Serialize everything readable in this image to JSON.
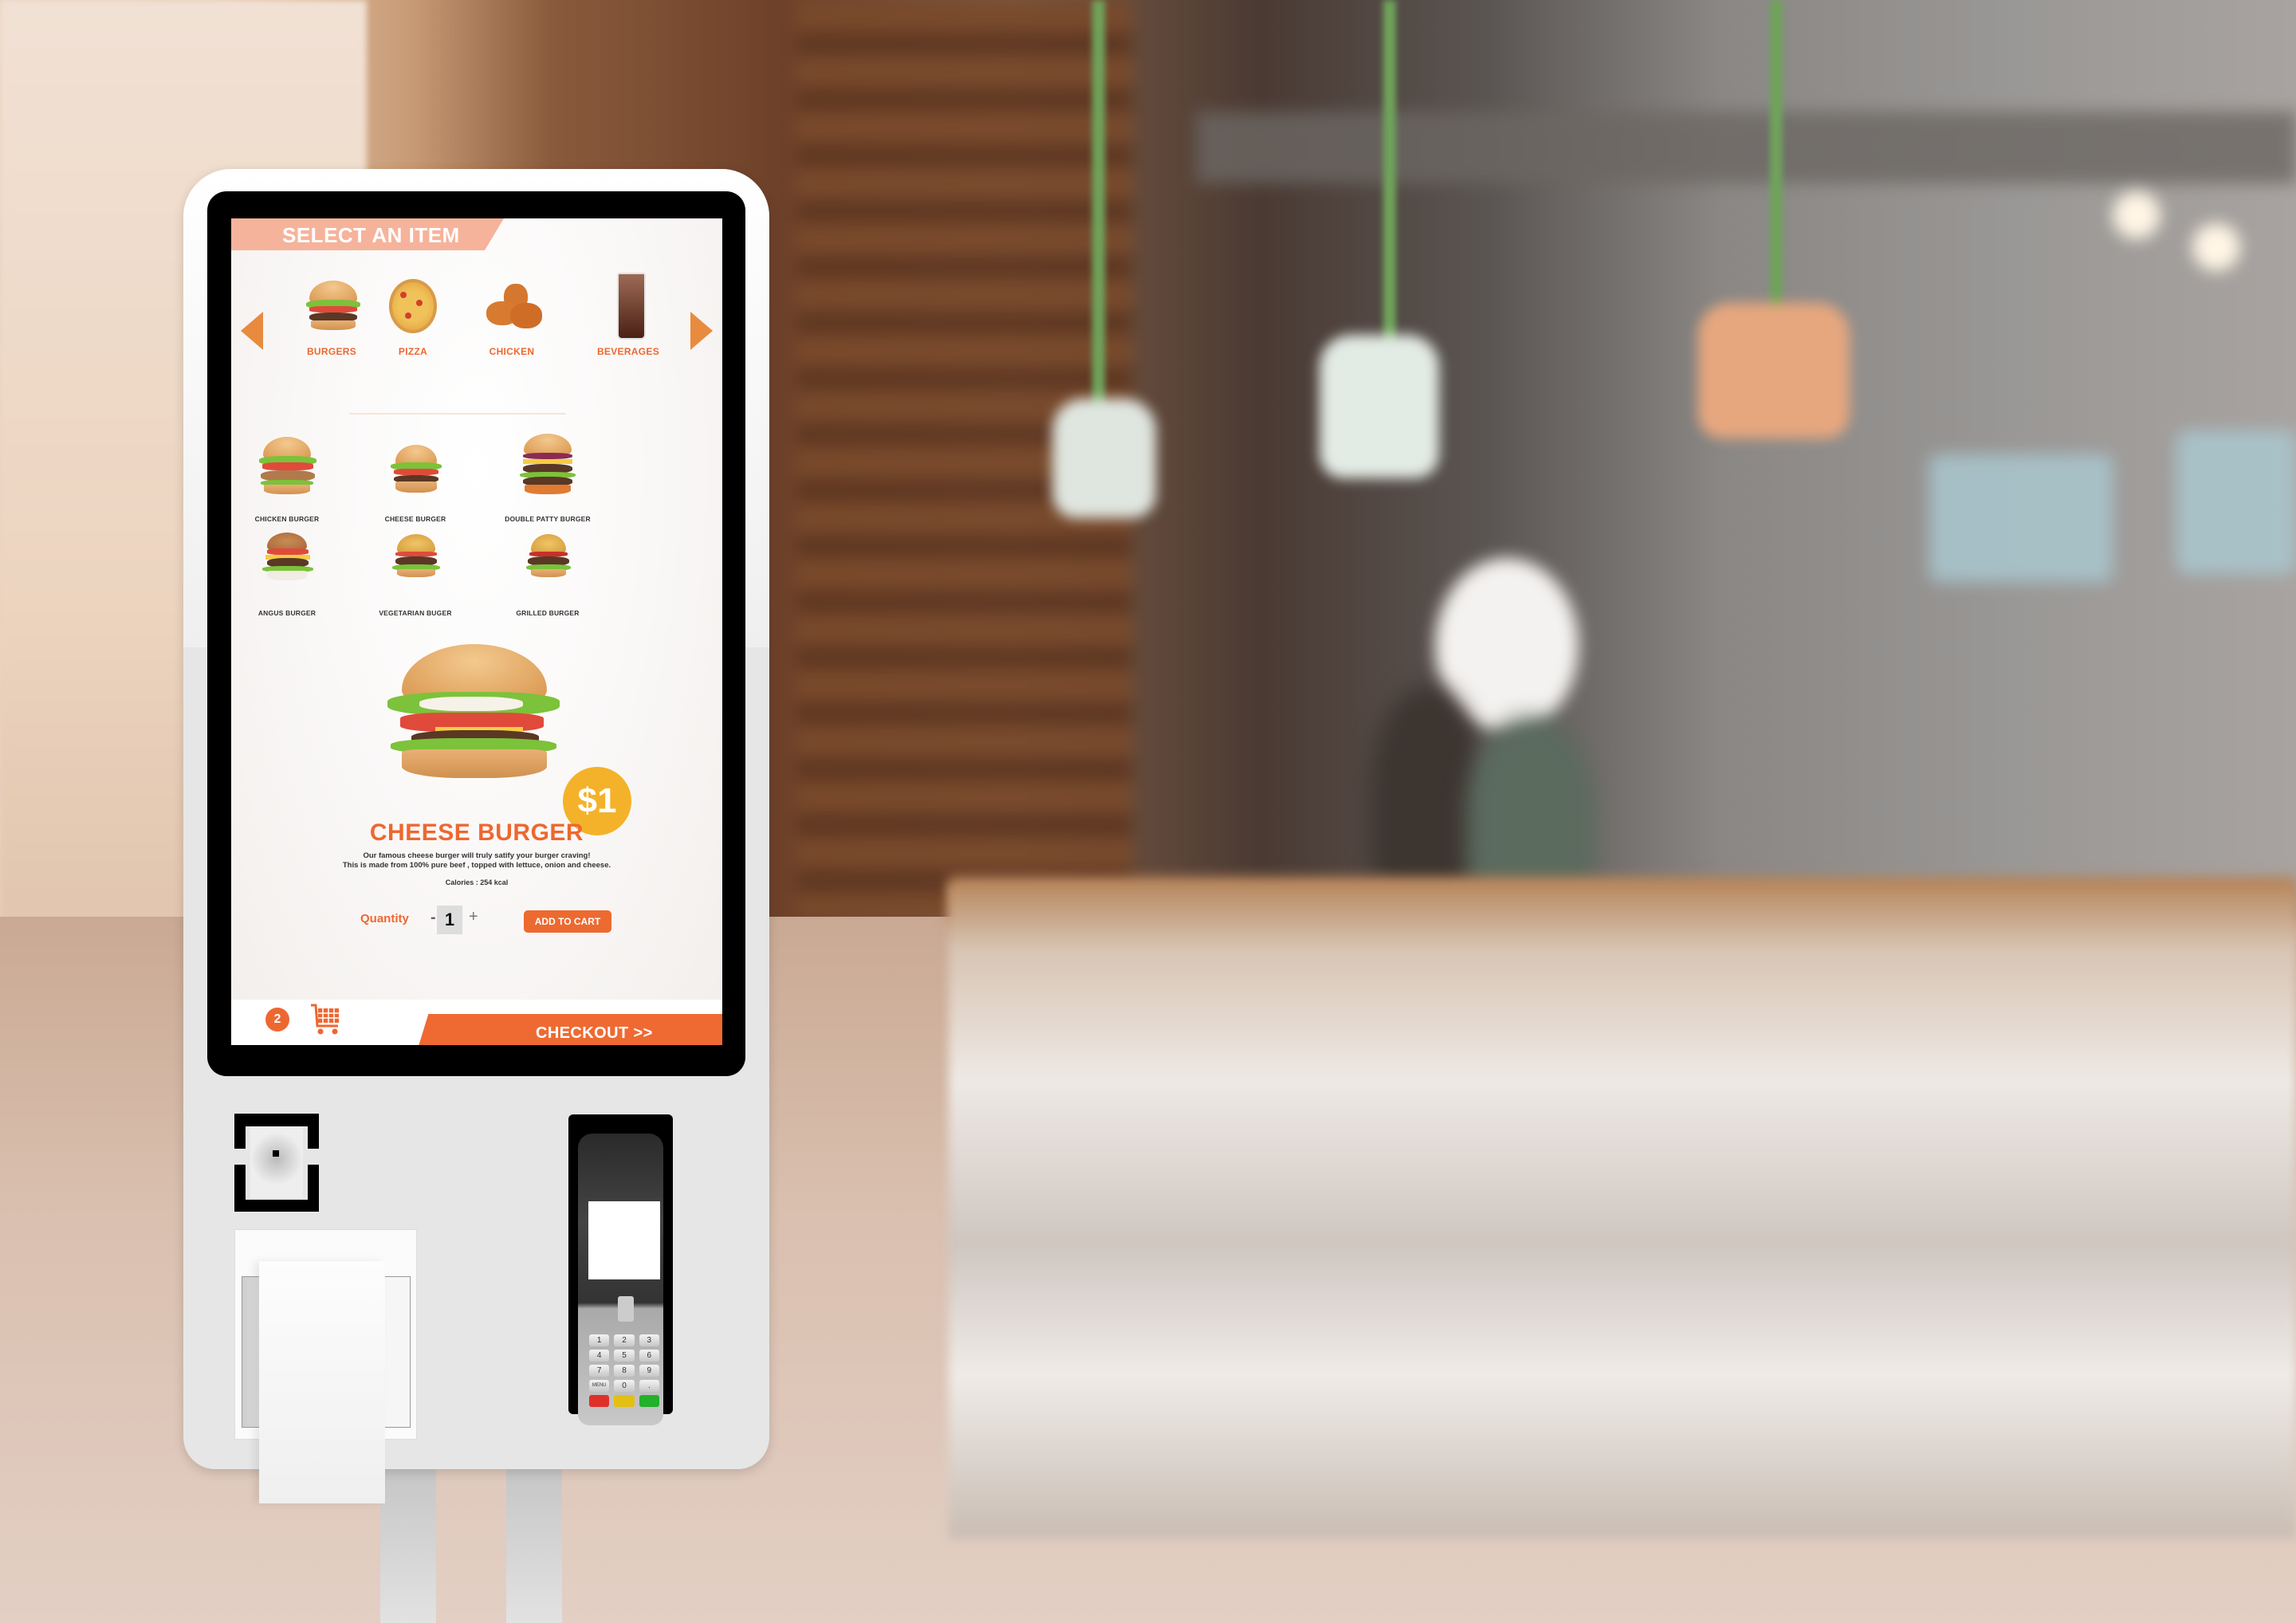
{
  "screen": {
    "header": "SELECT AN ITEM",
    "nav": {
      "prev": "previous-category",
      "next": "next-category"
    },
    "categories": [
      {
        "label": "BURGERS",
        "icon": "burger-icon"
      },
      {
        "label": "PIZZA",
        "icon": "pizza-icon"
      },
      {
        "label": "CHICKEN",
        "icon": "chicken-icon"
      },
      {
        "label": "BEVERAGES",
        "icon": "beverage-icon"
      }
    ],
    "items": [
      {
        "label": "CHICKEN BURGER"
      },
      {
        "label": "CHEESE BURGER"
      },
      {
        "label": "DOUBLE PATTY BURGER"
      },
      {
        "label": "ANGUS BURGER"
      },
      {
        "label": "VEGETARIAN BUGER"
      },
      {
        "label": "GRILLED BURGER"
      }
    ],
    "selected": {
      "name": "CHEESE BURGER",
      "price": "$1",
      "description_line1": "Our famous cheese burger will truly satify your burger craving!",
      "description_line2": "This is made from 100% pure beef , topped with lettuce, onion and cheese.",
      "calories": "Calories : 254 kcal"
    },
    "quantity": {
      "label": "Quantity",
      "minus": "-",
      "value": "1",
      "plus": "+"
    },
    "add_to_cart": "ADD TO CART",
    "cart_count": "2",
    "checkout": "CHECKOUT >>"
  },
  "colors": {
    "accent": "#ee6730",
    "banner": "#f6b39b",
    "price": "#f4b22a",
    "arrow": "#e88b3e"
  },
  "pos_terminal": {
    "keys": [
      "1",
      "2",
      "3",
      "4",
      "5",
      "6",
      "7",
      "8",
      "9",
      "MENU",
      "0",
      "."
    ]
  }
}
